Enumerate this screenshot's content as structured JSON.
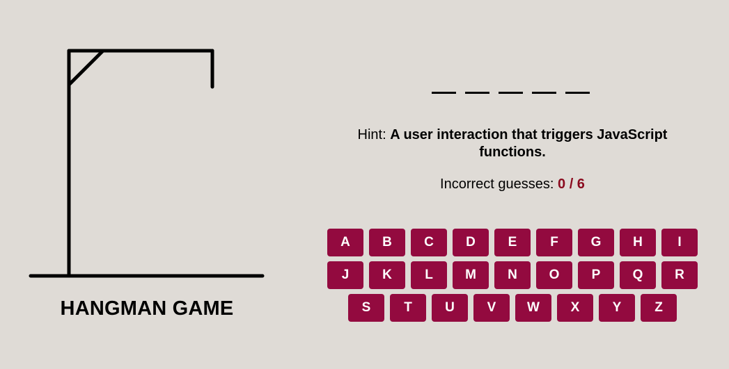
{
  "title": "HANGMAN GAME",
  "word_slots": [
    "",
    "",
    "",
    "",
    ""
  ],
  "hint": {
    "label": "Hint: ",
    "text": "A user interaction that triggers JavaScript functions."
  },
  "guesses": {
    "label": "Incorrect guesses: ",
    "value": "0 / 6"
  },
  "keyboard": {
    "rows": [
      [
        "A",
        "B",
        "C",
        "D",
        "E",
        "F",
        "G",
        "H",
        "I"
      ],
      [
        "J",
        "K",
        "L",
        "M",
        "N",
        "O",
        "P",
        "Q",
        "R"
      ],
      [
        "S",
        "T",
        "U",
        "V",
        "W",
        "X",
        "Y",
        "Z"
      ]
    ]
  },
  "colors": {
    "background": "#dfdbd6",
    "key_bg": "#930a3f",
    "key_text": "#ffffff",
    "guess_value": "#8a0a1e"
  }
}
